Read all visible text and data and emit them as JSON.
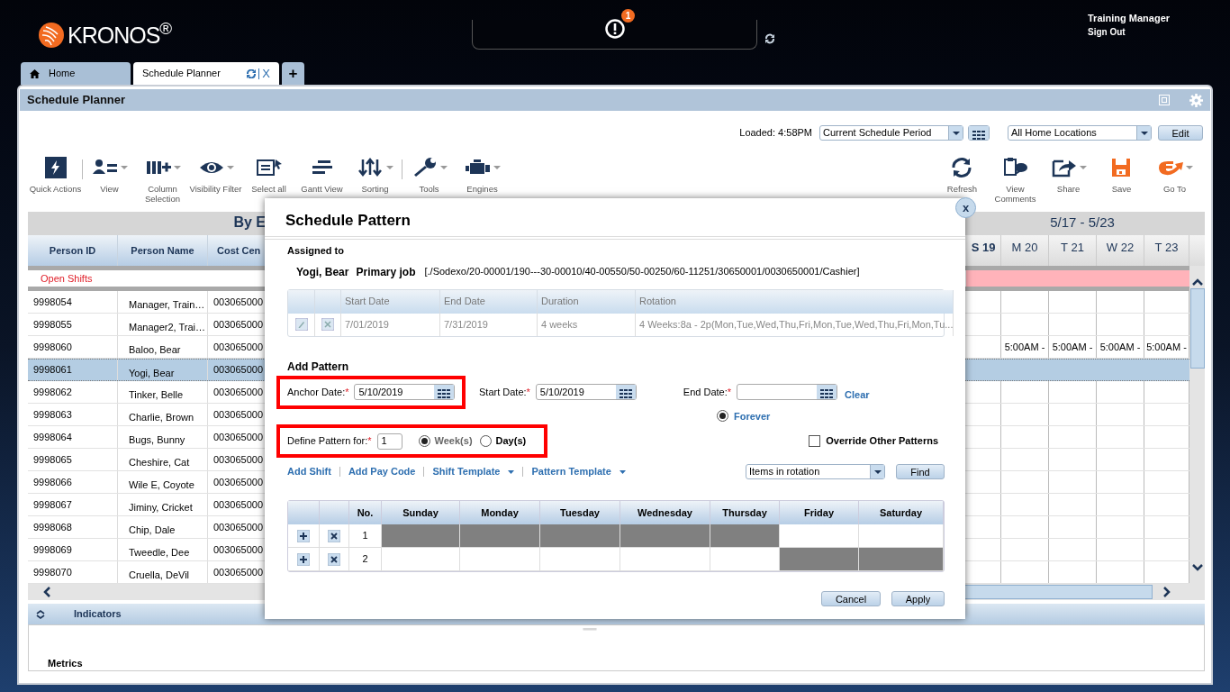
{
  "header": {
    "logo": "KRONOS$^{®}$",
    "notification_count": "1",
    "user_name": "Training Manager",
    "sign_out": "Sign Out"
  },
  "tabs": [
    {
      "kind": "home",
      "label": "Home",
      "selected": false
    },
    {
      "kind": "page",
      "label": "Schedule Planner",
      "selected": true,
      "close": "X"
    },
    {
      "kind": "add",
      "label": "+",
      "selected": false
    }
  ],
  "panel": {
    "title": "Schedule Planner"
  },
  "loaded": "Loaded: 4:58PM",
  "period_select": {
    "value": "Current Schedule Period"
  },
  "location_select": {
    "value": "All Home Locations"
  },
  "edit_button": "Edit",
  "toolbar_left": [
    {
      "label": "Quick Actions",
      "dropdown": false,
      "separator_before": false
    },
    {
      "label": "View",
      "dropdown": true,
      "separator_before": true
    },
    {
      "label": "Column Selection",
      "dropdown": true,
      "separator_before": false
    },
    {
      "label": "Visibility Filter",
      "dropdown": true,
      "separator_before": false
    },
    {
      "label": "Select all",
      "dropdown": false,
      "separator_before": false
    },
    {
      "label": "Gantt View",
      "dropdown": false,
      "separator_before": false
    },
    {
      "label": "Sorting",
      "dropdown": true,
      "separator_before": false
    },
    {
      "label": "Tools",
      "dropdown": true,
      "separator_before": true
    },
    {
      "label": "Engines",
      "dropdown": true,
      "separator_before": false
    }
  ],
  "toolbar_right": [
    {
      "label": "Refresh",
      "dropdown": false
    },
    {
      "label": "View Comments",
      "dropdown": false
    },
    {
      "label": "Share",
      "dropdown": true
    },
    {
      "label": "Save",
      "dropdown": false
    },
    {
      "label": "Go To",
      "dropdown": true
    }
  ],
  "grid": {
    "group_title": "By E",
    "columns": [
      "Person ID",
      "Person Name",
      "Cost Cen"
    ],
    "week_title": "5/17 - 5/23",
    "day_columns": [
      "S 19",
      "M 20",
      "T 21",
      "W 22",
      "T 23"
    ],
    "open_shifts": "Open Shifts",
    "rows": [
      {
        "id": "9998054",
        "name": "Manager, Train…",
        "cost_center": "003065000",
        "selected": false
      },
      {
        "id": "9998055",
        "name": "Manager2, Trai…",
        "cost_center": "003065000",
        "selected": false
      },
      {
        "id": "9998060",
        "name": "Baloo, Bear",
        "cost_center": "003065000",
        "selected": false,
        "shifts": [
          "5:00AM -",
          "5:00AM -",
          "5:00AM -",
          "5:00AM -"
        ]
      },
      {
        "id": "9998061",
        "name": "Yogi, Bear",
        "cost_center": "003065000",
        "selected": true
      },
      {
        "id": "9998062",
        "name": "Tinker, Belle",
        "cost_center": "003065000",
        "selected": false
      },
      {
        "id": "9998063",
        "name": "Charlie, Brown",
        "cost_center": "003065000",
        "selected": false
      },
      {
        "id": "9998064",
        "name": "Bugs, Bunny",
        "cost_center": "003065000",
        "selected": false
      },
      {
        "id": "9998065",
        "name": "Cheshire, Cat",
        "cost_center": "003065000",
        "selected": false
      },
      {
        "id": "9998066",
        "name": "Wile E, Coyote",
        "cost_center": "003065000",
        "selected": false
      },
      {
        "id": "9998067",
        "name": "Jiminy, Cricket",
        "cost_center": "003065000",
        "selected": false
      },
      {
        "id": "9998068",
        "name": "Chip, Dale",
        "cost_center": "003065000",
        "selected": false
      },
      {
        "id": "9998069",
        "name": "Tweedle, Dee",
        "cost_center": "003065000",
        "selected": false
      },
      {
        "id": "9998070",
        "name": "Cruella, DeVil",
        "cost_center": "003065000",
        "selected": false
      }
    ]
  },
  "indicators": {
    "label": "Indicators"
  },
  "metrics": {
    "label": "Metrics"
  },
  "dialog": {
    "title": "Schedule Pattern",
    "close": "x",
    "required_mark": "*",
    "assigned_label": "Assigned to",
    "employee": "Yogi, Bear",
    "job_label": "Primary job",
    "job_path": "[./Sodexo/20-00001/190---30-00010/40-00550/50-00250/60-11251/30650001/0030650001/Cashier]",
    "patterns_table": {
      "columns": [
        "Start Date",
        "End Date",
        "Duration",
        "Rotation"
      ],
      "rows": [
        {
          "start": "7/01/2019",
          "end": "7/31/2019",
          "duration": "4 weeks",
          "rotation": "4 Weeks:8a - 2p(Mon,Tue,Wed,Thu,Fri,Mon,Tue,Wed,Thu,Fri,Mon,Tu..."
        }
      ]
    },
    "add_pattern": {
      "title": "Add Pattern",
      "anchor_date": {
        "label": "Anchor Date:",
        "value": "5/10/2019",
        "required": true,
        "highlighted": true
      },
      "start_date": {
        "label": "Start Date:",
        "value": "5/10/2019",
        "required": true,
        "highlighted": false
      },
      "end_date": {
        "label": "End Date:",
        "required": true,
        "highlighted": false
      },
      "clear": "Clear",
      "forever": {
        "label": "Forever",
        "selected": true
      },
      "define": {
        "label": "Define Pattern for:",
        "value": "1",
        "required": true,
        "highlighted": true,
        "units": [
          {
            "label": "Week(s)",
            "selected": true
          },
          {
            "label": "Day(s)",
            "selected": false
          }
        ]
      },
      "override": {
        "label": "Override Other Patterns",
        "checked": false
      },
      "links": [
        {
          "label": "Add Shift",
          "dropdown": false
        },
        {
          "label": "Add Pay Code",
          "dropdown": false
        },
        {
          "label": "Shift Template",
          "dropdown": true
        },
        {
          "label": "Pattern Template",
          "dropdown": true
        }
      ],
      "rotation_select": "Items in rotation",
      "find": "Find"
    },
    "pattern_table": {
      "columns": [
        "No.",
        "Sunday",
        "Monday",
        "Tuesday",
        "Wednesday",
        "Thursday",
        "Friday",
        "Saturday"
      ],
      "rows": [
        {
          "no": "1",
          "filled": [
            true,
            true,
            true,
            true,
            true,
            false,
            false
          ]
        },
        {
          "no": "2",
          "filled": [
            false,
            false,
            false,
            false,
            false,
            true,
            true
          ]
        }
      ]
    },
    "buttons": [
      "Cancel",
      "Apply"
    ]
  }
}
